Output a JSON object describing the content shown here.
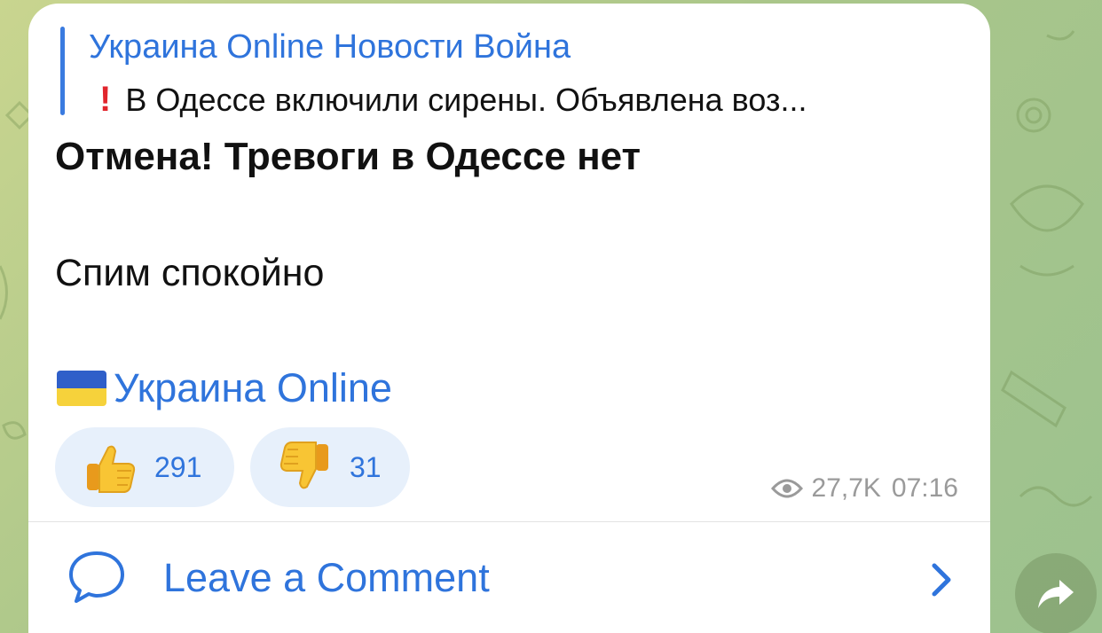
{
  "reply": {
    "channel_title": "Украина Online Новости Война",
    "snippet_icon": "exclamation-mark-emoji",
    "snippet": "В Одессе включили сирены. Объявлена воз..."
  },
  "message": {
    "title": "Отмена! Тревоги в Одессе нет",
    "line": "Спим спокойно",
    "signature_flag": "ukraine-flag-emoji",
    "signature": "Украина Online"
  },
  "reactions": [
    {
      "icon": "thumbs-up-emoji",
      "count": "291"
    },
    {
      "icon": "thumbs-down-emoji",
      "count": "31"
    }
  ],
  "meta": {
    "views_icon": "eye-icon",
    "views": "27,7K",
    "time": "07:16"
  },
  "comments": {
    "icon": "speech-bubble-icon",
    "label": "Leave a Comment",
    "chevron": "chevron-right-icon"
  },
  "share": {
    "icon": "share-arrow-icon"
  },
  "colors": {
    "accent": "#2f74dc",
    "reaction_bg": "#e7f0fb",
    "reply_bar": "#3a7be0",
    "exclamation": "#e1262d",
    "meta_text": "#9a9a9a"
  }
}
